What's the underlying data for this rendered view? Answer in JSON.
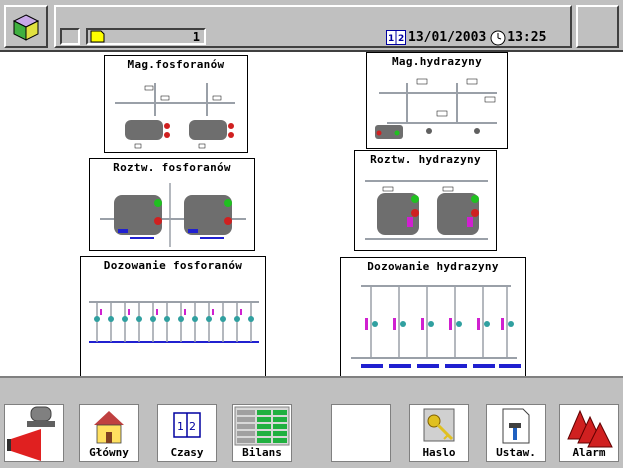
{
  "header": {
    "page_number": "1",
    "date": "13/01/2003",
    "time": "13:25"
  },
  "screens": [
    {
      "title": "Mag.fosforanów"
    },
    {
      "title": "Mag.hydrazyny"
    },
    {
      "title": "Roztw. fosforanów"
    },
    {
      "title": "Roztw. hydrazyny"
    },
    {
      "title": "Dozowanie fosforanów"
    },
    {
      "title": "Dozowanie hydrazyny"
    }
  ],
  "toolbar": {
    "glowny": "Główny",
    "czasy": "Czasy",
    "bilans": "Bilans",
    "haslo": "Haslo",
    "ustaw": "Ustaw.",
    "alarm": "Alarm"
  },
  "colors": {
    "tank": "#6e6e6e",
    "valve_red": "#d02020",
    "valve_green": "#20c020",
    "label_blue": "#2020d0",
    "pipe": "#9aa0a8"
  },
  "icons": [
    "cube-icon",
    "page-icon",
    "calendar-icon",
    "clock-icon",
    "siren-icon",
    "home-icon",
    "book-icon",
    "grid-icon",
    "key-icon",
    "document-hammer-icon",
    "alarm-triangles-icon"
  ]
}
